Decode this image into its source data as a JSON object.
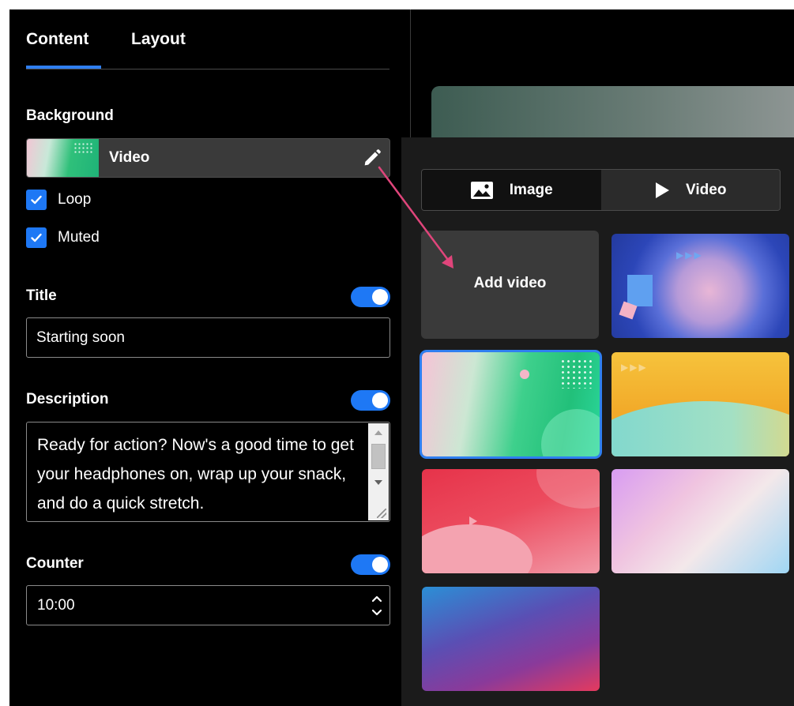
{
  "tabs": {
    "content": "Content",
    "layout": "Layout",
    "active": "content"
  },
  "background": {
    "section_label": "Background",
    "selected_label": "Video",
    "options": {
      "loop": "Loop",
      "muted": "Muted"
    }
  },
  "title": {
    "section_label": "Title",
    "enabled": true,
    "value": "Starting soon"
  },
  "description": {
    "section_label": "Description",
    "enabled": true,
    "value": "Ready for action? Now's a good time to get your headphones on, wrap up your snack, and do a quick stretch."
  },
  "counter": {
    "section_label": "Counter",
    "enabled": true,
    "value": "10:00"
  },
  "picker": {
    "image_tab": "Image",
    "video_tab": "Video",
    "add_video": "Add video",
    "thumbnails": [
      "blue-abstract",
      "green-gradient",
      "yellow-wave",
      "red-wave",
      "pastel-gradient",
      "purple-gradient"
    ],
    "selected": "green-gradient"
  },
  "colors": {
    "accent": "#1e78f5",
    "annotation_arrow": "#e0457b",
    "panel": "#1b1b1b"
  },
  "icons": {
    "edit": "pencil-icon",
    "image": "image-icon",
    "video": "play-icon",
    "check": "check-icon"
  }
}
